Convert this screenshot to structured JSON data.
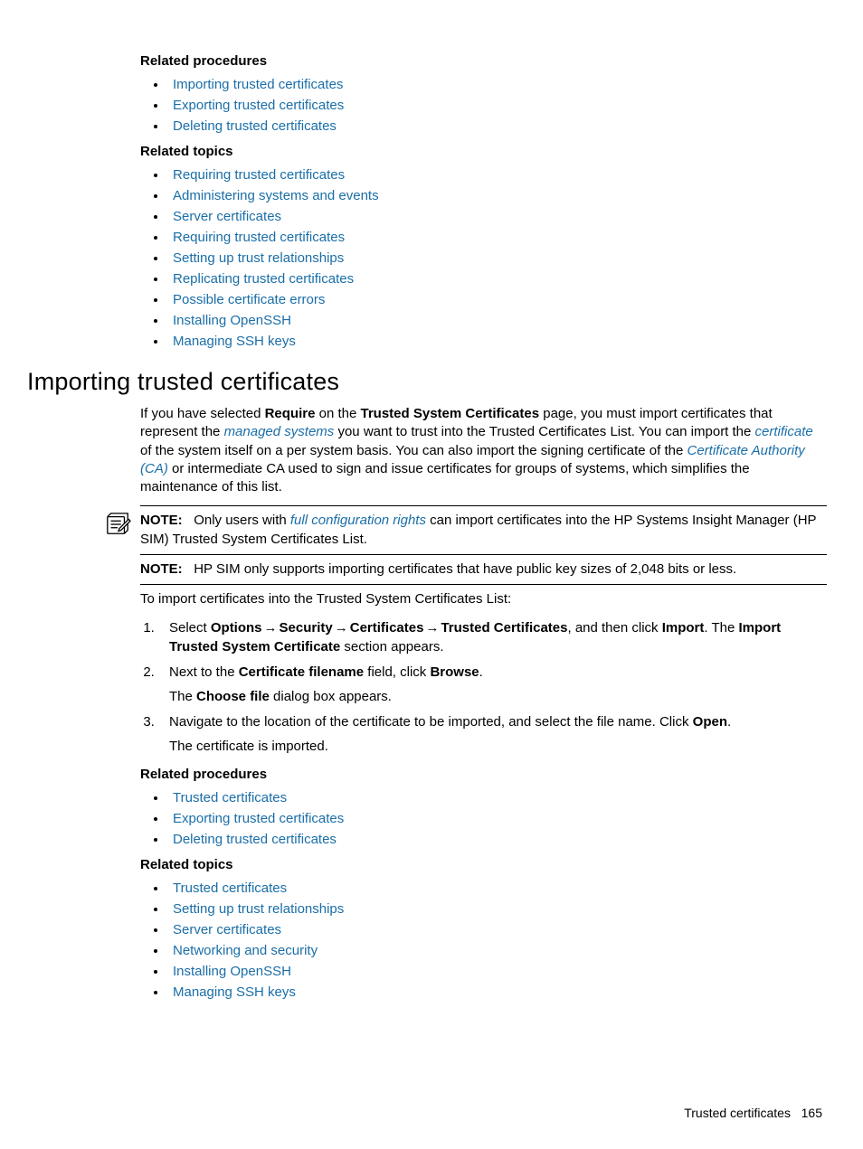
{
  "top": {
    "relatedProceduresHeading": "Related procedures",
    "relatedProcedures": [
      "Importing trusted certificates",
      "Exporting trusted certificates",
      "Deleting trusted certificates"
    ],
    "relatedTopicsHeading": "Related topics",
    "relatedTopics": [
      "Requiring trusted certificates",
      "Administering systems and events",
      "Server certificates",
      "Requiring trusted certificates",
      "Setting up trust relationships",
      "Replicating trusted certificates",
      "Possible certificate errors",
      "Installing OpenSSH",
      "Managing SSH keys"
    ]
  },
  "section": {
    "title": "Importing trusted certificates",
    "intro": {
      "p1a": "If you have selected ",
      "require": "Require",
      "p1b": " on the ",
      "tsc": "Trusted System Certificates",
      "p1c": " page, you must import certificates that represent the ",
      "managedSystems": "managed systems",
      "p1d": " you want to trust into the Trusted Certificates List. You can import the ",
      "certificate": "certificate",
      "p1e": " of the system itself on a per system basis. You can also import the signing certificate of the ",
      "ca": "Certificate Authority (CA)",
      "p1f": " or intermediate CA used to sign and issue certificates for groups of systems, which simplifies the maintenance of this list."
    },
    "note1": {
      "label": "NOTE:",
      "a": "Only users with ",
      "rights": "full configuration rights",
      "b": " can import certificates into the HP Systems Insight Manager (HP SIM) Trusted System Certificates List."
    },
    "note2": {
      "label": "NOTE:",
      "text": "HP SIM only supports importing certificates that have public key sizes of 2,048 bits or less."
    },
    "lead": "To import certificates into the Trusted System Certificates List:",
    "steps": {
      "s1": {
        "select": "Select ",
        "options": "Options",
        "security": "Security",
        "certificates": "Certificates",
        "trusted": "Trusted Certificates",
        "mid": ", and then click ",
        "import": "Import",
        "mid2": ". The ",
        "itsc": "Import Trusted System Certificate",
        "end": " section appears."
      },
      "s2": {
        "a": "Next to the ",
        "cfn": "Certificate filename",
        "b": " field, click ",
        "browse": "Browse",
        "c": ".",
        "sub_a": "The ",
        "cf": "Choose file",
        "sub_b": " dialog box appears."
      },
      "s3": {
        "a": "Navigate to the location of the certificate to be imported, and select the file name. Click ",
        "open": "Open",
        "b": ".",
        "sub": "The certificate is imported."
      }
    },
    "relatedProceduresHeading": "Related procedures",
    "relatedProcedures": [
      "Trusted certificates",
      "Exporting trusted certificates",
      "Deleting trusted certificates"
    ],
    "relatedTopicsHeading": "Related topics",
    "relatedTopics": [
      "Trusted certificates",
      "Setting up trust relationships",
      "Server certificates",
      "Networking and security",
      "Installing OpenSSH",
      "Managing SSH keys"
    ]
  },
  "footer": {
    "text": "Trusted certificates",
    "page": "165"
  },
  "arrow": "→"
}
